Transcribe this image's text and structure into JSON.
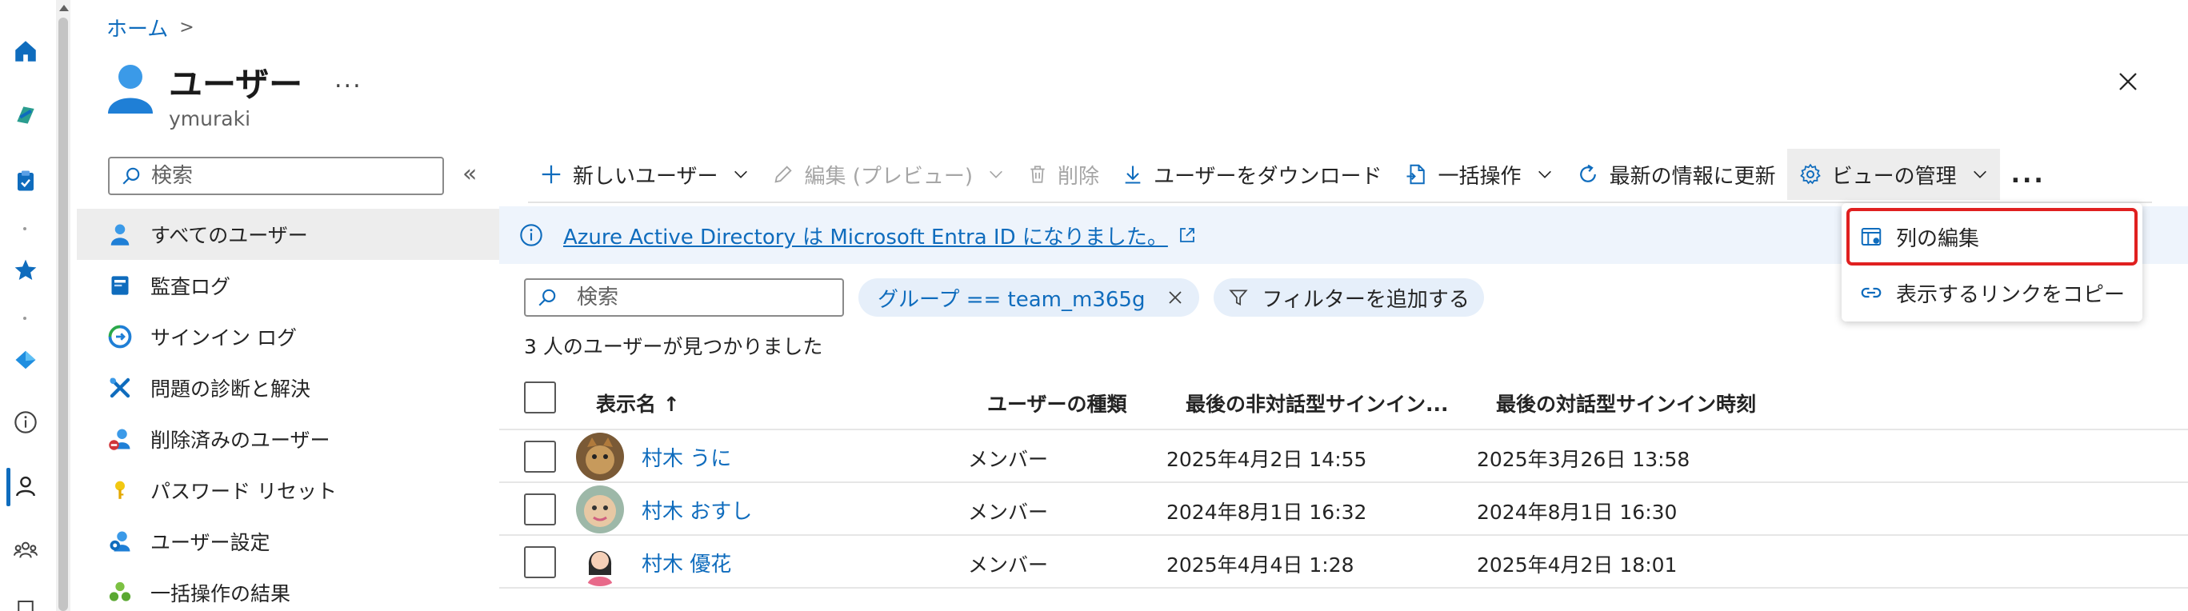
{
  "breadcrumb": {
    "home": "ホーム",
    "separator": ">"
  },
  "header": {
    "title": "ユーザー",
    "subtitle": "ymuraki",
    "more": "...",
    "close_icon": "close-icon"
  },
  "nav": {
    "search_placeholder": "検索",
    "collapse": "«",
    "items": [
      {
        "label": "すべてのユーザー",
        "icon": "user-icon",
        "active": true
      },
      {
        "label": "監査ログ",
        "icon": "audit-log-icon"
      },
      {
        "label": "サインイン ログ",
        "icon": "sign-in-log-icon"
      },
      {
        "label": "問題の診断と解決",
        "icon": "wrench-icon"
      },
      {
        "label": "削除済みのユーザー",
        "icon": "deleted-user-icon"
      },
      {
        "label": "パスワード リセット",
        "icon": "key-icon"
      },
      {
        "label": "ユーザー設定",
        "icon": "user-settings-icon"
      },
      {
        "label": "一括操作の結果",
        "icon": "bulk-results-icon"
      }
    ]
  },
  "toolbar": {
    "new_user": "新しいユーザー",
    "edit_preview": "編集 (プレビュー)",
    "delete": "削除",
    "download": "ユーザーをダウンロード",
    "bulk": "一括操作",
    "refresh": "最新の情報に更新",
    "manage_view": "ビューの管理",
    "more": "..."
  },
  "banner": {
    "text": "Azure Active Directory は Microsoft Entra ID になりました。"
  },
  "filters": {
    "search_placeholder": "検索",
    "group_filter": "グループ == team_m365g",
    "add_filter": "フィルターを追加する"
  },
  "result_count": "3 人のユーザーが見つかりました",
  "table": {
    "columns": [
      "表示名 ↑",
      "ユーザーの種類",
      "最後の非対話型サインイン...",
      "最後の対話型サインイン時刻"
    ],
    "rows": [
      {
        "name": "村木 うに",
        "type": "メンバー",
        "last_noninteractive": "2025年4月2日 14:55",
        "last_interactive": "2025年3月26日 13:58"
      },
      {
        "name": "村木 おすし",
        "type": "メンバー",
        "last_noninteractive": "2024年8月1日 16:32",
        "last_interactive": "2024年8月1日 16:30"
      },
      {
        "name": "村木 優花",
        "type": "メンバー",
        "last_noninteractive": "2025年4月4日 1:28",
        "last_interactive": "2025年4月2日 18:01"
      }
    ]
  },
  "view_menu": {
    "edit_columns": "列の編集",
    "copy_link": "表示するリンクをコピー"
  },
  "colors": {
    "accent": "#0f6cbd",
    "highlight_border": "#e02020",
    "banner_bg": "#eef4fc"
  }
}
